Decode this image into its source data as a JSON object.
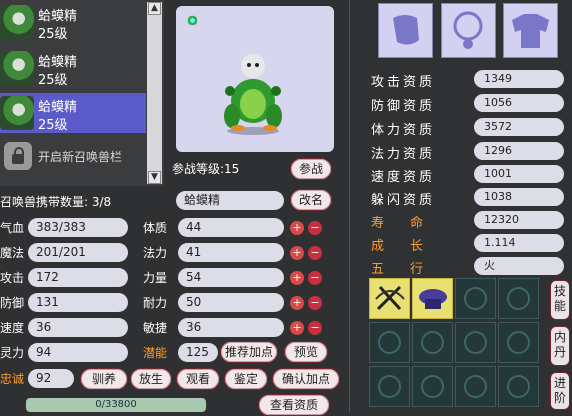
{
  "pets": [
    {
      "name": "蛤蟆精",
      "level": "25级",
      "selected": false
    },
    {
      "name": "蛤蟆精",
      "level": "25级",
      "selected": false
    },
    {
      "name": "蛤蟆精",
      "level": "25级",
      "selected": true
    }
  ],
  "open_slot_label": "开启新召唤兽栏",
  "battle_level_label": "参战等级:15",
  "battle_button": "参战",
  "carry_count_label": "召唤兽携带数量: 3/8",
  "pet_name_value": "蛤蟆精",
  "rename_button": "改名",
  "stats_left": [
    {
      "label": "气血",
      "value": "383/383"
    },
    {
      "label": "魔法",
      "value": "201/201"
    },
    {
      "label": "攻击",
      "value": "172"
    },
    {
      "label": "防御",
      "value": "131"
    },
    {
      "label": "速度",
      "value": "36"
    },
    {
      "label": "灵力",
      "value": "94"
    }
  ],
  "attrs": [
    {
      "label": "体质",
      "value": "44"
    },
    {
      "label": "法力",
      "value": "41"
    },
    {
      "label": "力量",
      "value": "54"
    },
    {
      "label": "耐力",
      "value": "50"
    },
    {
      "label": "敏捷",
      "value": "36"
    }
  ],
  "potential": {
    "label": "潜能",
    "value": "125"
  },
  "recommend_button": "推荐加点",
  "preview_button": "预览",
  "loyalty": {
    "label": "忠诚",
    "value": "92"
  },
  "bottom_buttons": [
    "驯养",
    "放生",
    "观看",
    "鉴定",
    "确认加点"
  ],
  "exp_bar": {
    "text": "0/33800",
    "fraction": 0.0
  },
  "view_qual_button": "查看资质",
  "qualities": [
    {
      "label": "攻击资质",
      "value": "1349"
    },
    {
      "label": "防御资质",
      "value": "1056"
    },
    {
      "label": "体力资质",
      "value": "3572"
    },
    {
      "label": "法力资质",
      "value": "1296"
    },
    {
      "label": "速度资质",
      "value": "1001"
    },
    {
      "label": "躲闪资质",
      "value": "1038"
    }
  ],
  "specials": [
    {
      "label": "寿　　命",
      "value": "12320"
    },
    {
      "label": "成　　长",
      "value": "1.114"
    },
    {
      "label": "五　　行",
      "value": "火"
    }
  ],
  "tabs": [
    "技能",
    "内丹",
    "进阶"
  ],
  "equip_icons": [
    "collar-icon",
    "necklace-icon",
    "armor-icon"
  ],
  "colors": {
    "accent_red": "#7a2430",
    "orange": "#ff9d2a",
    "selection": "#5a5ac8"
  }
}
